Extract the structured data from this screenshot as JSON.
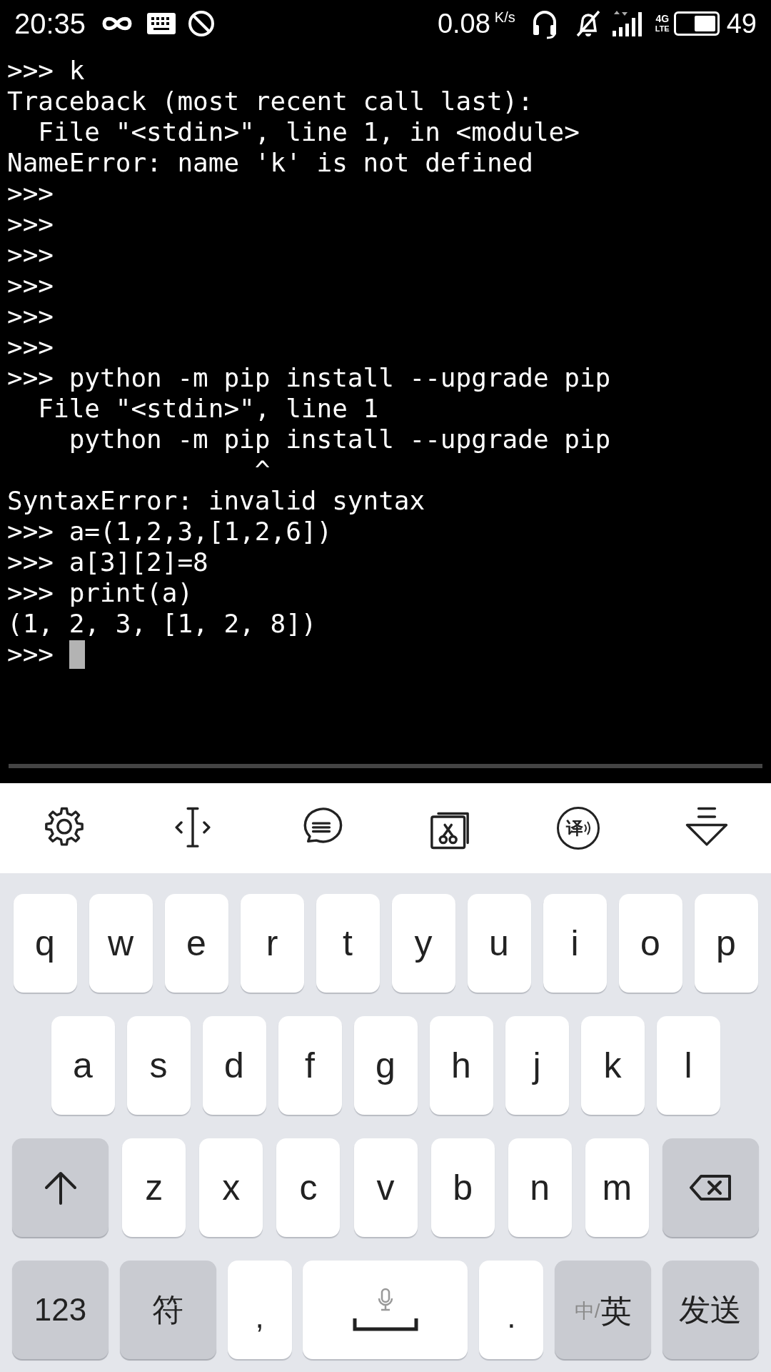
{
  "status_bar": {
    "time": "20:35",
    "speed": "0.08",
    "speed_unit": "K/s",
    "network_top": "4G",
    "network_bottom": "LTE",
    "battery": "49"
  },
  "terminal": {
    "lines": [
      ">>> k",
      "Traceback (most recent call last):",
      "  File \"<stdin>\", line 1, in <module>",
      "NameError: name 'k' is not defined",
      ">>>",
      ">>>",
      ">>>",
      ">>>",
      ">>>",
      ">>>",
      ">>> python -m pip install --upgrade pip",
      "  File \"<stdin>\", line 1",
      "    python -m pip install --upgrade pip",
      "                ^",
      "SyntaxError: invalid syntax",
      ">>> a=(1,2,3,[1,2,6])",
      ">>> a[3][2]=8",
      ">>> print(a)",
      "(1, 2, 3, [1, 2, 8])",
      ">>> "
    ],
    "cursor": true
  },
  "toolbar": [
    {
      "kind": "settings"
    },
    {
      "kind": "cursor"
    },
    {
      "kind": "chat"
    },
    {
      "kind": "clipboard"
    },
    {
      "kind": "translate",
      "glyph": "译"
    },
    {
      "kind": "hide"
    }
  ],
  "keyboard": {
    "top_row": [
      {
        "kind": "letter",
        "label": "q"
      },
      {
        "kind": "letter",
        "label": "w"
      },
      {
        "kind": "letter",
        "label": "e"
      },
      {
        "kind": "letter",
        "label": "r"
      },
      {
        "kind": "letter",
        "label": "t"
      },
      {
        "kind": "letter",
        "label": "y"
      },
      {
        "kind": "letter",
        "label": "u"
      },
      {
        "kind": "letter",
        "label": "i"
      },
      {
        "kind": "letter",
        "label": "o"
      },
      {
        "kind": "letter",
        "label": "p"
      }
    ],
    "middle_row": [
      {
        "kind": "letter",
        "label": "a"
      },
      {
        "kind": "letter",
        "label": "s"
      },
      {
        "kind": "letter",
        "label": "d"
      },
      {
        "kind": "letter",
        "label": "f"
      },
      {
        "kind": "letter",
        "label": "g"
      },
      {
        "kind": "letter",
        "label": "h"
      },
      {
        "kind": "letter",
        "label": "j"
      },
      {
        "kind": "letter",
        "label": "k"
      },
      {
        "kind": "letter",
        "label": "l"
      }
    ],
    "lower_row": [
      {
        "kind": "shift"
      },
      {
        "kind": "letter",
        "label": "z"
      },
      {
        "kind": "letter",
        "label": "x"
      },
      {
        "kind": "letter",
        "label": "c"
      },
      {
        "kind": "letter",
        "label": "v"
      },
      {
        "kind": "letter",
        "label": "b"
      },
      {
        "kind": "letter",
        "label": "n"
      },
      {
        "kind": "letter",
        "label": "m"
      },
      {
        "kind": "backspace"
      }
    ],
    "bottom_row": [
      {
        "kind": "function",
        "label": "123"
      },
      {
        "kind": "function",
        "label": "符"
      },
      {
        "kind": "punct",
        "label": ","
      },
      {
        "kind": "space"
      },
      {
        "kind": "punct",
        "label": "."
      },
      {
        "kind": "lang",
        "label_dim": "中/",
        "label": "英"
      },
      {
        "kind": "function",
        "label": "发送"
      }
    ]
  }
}
